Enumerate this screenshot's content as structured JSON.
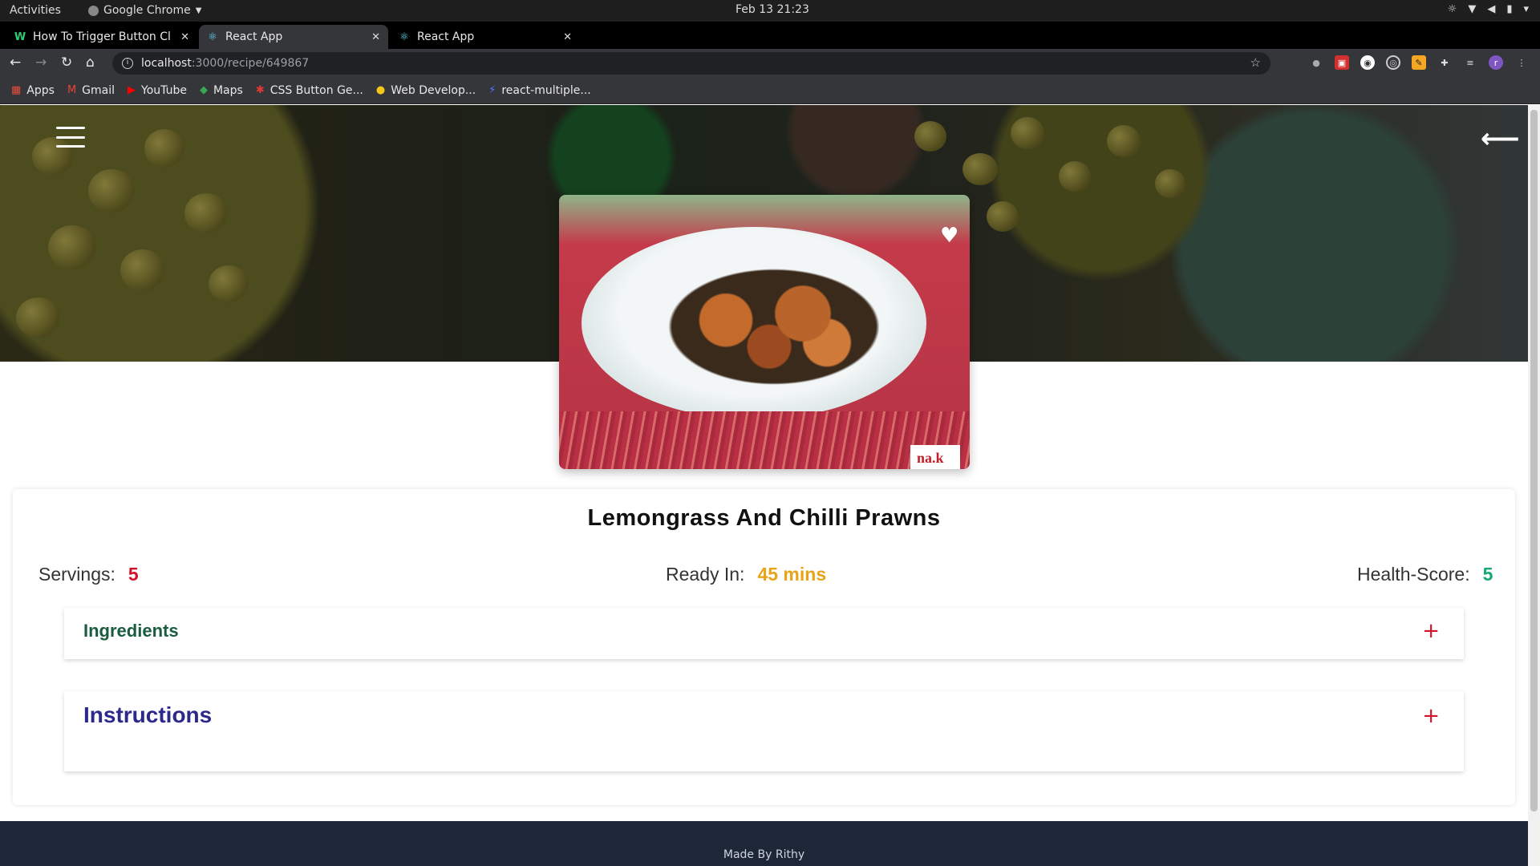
{
  "os_bar": {
    "activities": "Activities",
    "app_menu": "Google Chrome",
    "clock": "Feb 13  21:23"
  },
  "tabs": [
    {
      "title": "How To Trigger Button Cl",
      "active": false
    },
    {
      "title": "React App",
      "active": true
    },
    {
      "title": "React App",
      "active": false
    }
  ],
  "omnibox": {
    "host": "localhost",
    "path": ":3000/recipe/649867"
  },
  "bookmarks": [
    {
      "label": "Apps",
      "icon": "apps-grid-icon"
    },
    {
      "label": "Gmail",
      "icon": "gmail-icon"
    },
    {
      "label": "YouTube",
      "icon": "youtube-icon"
    },
    {
      "label": "Maps",
      "icon": "maps-icon"
    },
    {
      "label": "CSS Button Ge...",
      "icon": "css-icon"
    },
    {
      "label": "Web Develop...",
      "icon": "web-icon"
    },
    {
      "label": "react-multiple...",
      "icon": "bolt-icon"
    }
  ],
  "recipe": {
    "title": "Lemongrass And Chilli Prawns",
    "servings_label": "Servings:",
    "servings_value": "5",
    "ready_label": "Ready In:",
    "ready_value": "45 mins",
    "health_label": "Health-Score:",
    "health_value": "5",
    "image_stamp": "na.k"
  },
  "accordions": {
    "ingredients": "Ingredients",
    "instructions": "Instructions",
    "toggle": "+"
  },
  "footer": {
    "text": "Made By Rithy"
  },
  "colors": {
    "servings": "#d1122a",
    "ready": "#e8a317",
    "health": "#16a77c",
    "ingredients": "#1a5c3e",
    "instructions": "#2b2a8a",
    "footer_bg": "#1e2738"
  }
}
